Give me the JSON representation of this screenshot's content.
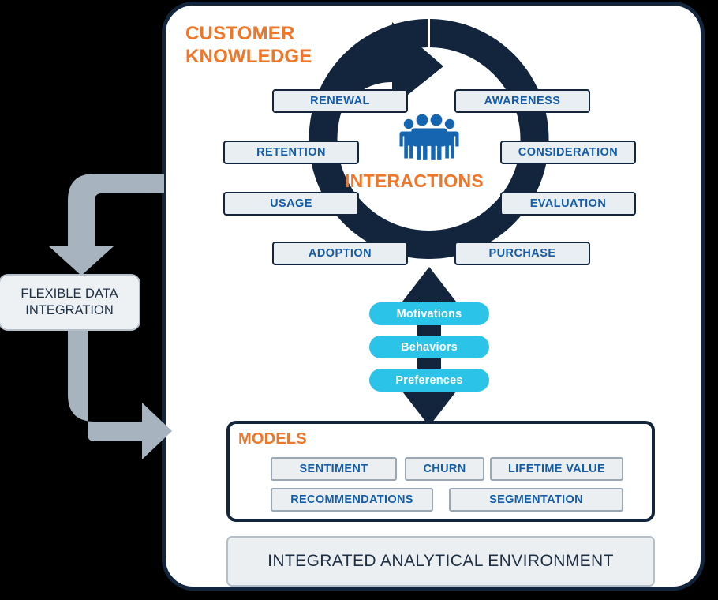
{
  "colors": {
    "background": "#000000",
    "card_fill": "#ffffff",
    "navy": "#12253d",
    "orange": "#f0762a",
    "blue_text": "#145ca8",
    "stage_fill": "#e9eef2",
    "cyan": "#2cc3e8",
    "gray_arrow": "#a8b3c0",
    "panel_gray": "#eceff1",
    "gray_border": "#9aa7b4"
  },
  "headings": {
    "customer_knowledge": "CUSTOMER\nKNOWLEDGE",
    "customer_knowledge_line1": "CUSTOMER",
    "customer_knowledge_line2": "KNOWLEDGE",
    "interactions": "INTERACTIONS",
    "models": "MODELS"
  },
  "lifecycle": {
    "note": "clockwise customer lifecycle ring, arrowhead at top pointing right",
    "stages": [
      {
        "label": "AWARENESS",
        "side": "right",
        "order": 1
      },
      {
        "label": "CONSIDERATION",
        "side": "right",
        "order": 2
      },
      {
        "label": "EVALUATION",
        "side": "right",
        "order": 3
      },
      {
        "label": "PURCHASE",
        "side": "right",
        "order": 4
      },
      {
        "label": "ADOPTION",
        "side": "left",
        "order": 5
      },
      {
        "label": "USAGE",
        "side": "left",
        "order": 6
      },
      {
        "label": "RETENTION",
        "side": "left",
        "order": 7
      },
      {
        "label": "RENEWAL",
        "side": "left",
        "order": 8
      }
    ]
  },
  "center_icon": {
    "name": "people-group-icon",
    "count": 4
  },
  "attributes": {
    "items": [
      {
        "label": "Motivations"
      },
      {
        "label": "Behaviors"
      },
      {
        "label": "Preferences"
      }
    ]
  },
  "models": {
    "title": "MODELS",
    "row1": [
      {
        "label": "SENTIMENT"
      },
      {
        "label": "CHURN"
      },
      {
        "label": "LIFETIME VALUE"
      }
    ],
    "row2": [
      {
        "label": "RECOMMENDATIONS"
      },
      {
        "label": "SEGMENTATION"
      }
    ]
  },
  "footer": {
    "label": "INTEGRATED ANALYTICAL ENVIRONMENT"
  },
  "data_integration": {
    "line1": "FLEXIBLE DATA",
    "line2": "INTEGRATION",
    "inbound_arrow": "arrow-in-from-card-down-into-box",
    "outbound_arrow": "arrow-out-from-box-right-into-card"
  }
}
